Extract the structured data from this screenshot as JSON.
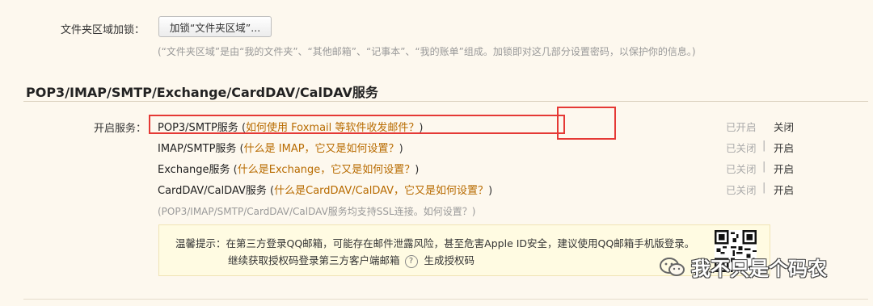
{
  "folder_lock": {
    "label": "文件夹区域加锁：",
    "button": "加锁“文件夹区域”...",
    "hint": "(“文件夹区域”是由“我的文件夹”、“其他邮箱”、“记事本”、“我的账单”组成。加锁即对这几部分设置密码，以保护你的信息。)"
  },
  "section": {
    "title": "POP3/IMAP/SMTP/Exchange/CardDAV/CalDAV服务"
  },
  "services": {
    "label": "开启服务：",
    "rows": [
      {
        "name": "POP3/SMTP服务",
        "open": " (",
        "help": "如何使用 Foxmail 等软件收发邮件？",
        "close": ")",
        "status": "已开启",
        "action": "关闭"
      },
      {
        "name": "IMAP/SMTP服务",
        "open": " (",
        "help": "什么是 IMAP，它又是如何设置？",
        "close": ")",
        "status": "已关闭",
        "action": "开启"
      },
      {
        "name": "Exchange服务",
        "open": " (",
        "help": "什么是Exchange，它又是如何设置？",
        "close": ")",
        "status": "已关闭",
        "action": "开启"
      },
      {
        "name": "CardDAV/CalDAV服务",
        "open": " (",
        "help": "什么是CardDAV/CalDAV，它又是如何设置？",
        "close": ")",
        "status": "已关闭",
        "action": "开启"
      }
    ],
    "separator": "|",
    "ssl_note": "(POP3/IMAP/SMTP/CardDAV/CalDAV服务均支持SSL连接。如何设置？)"
  },
  "warning": {
    "line1": "温馨提示：在第三方登录QQ邮箱，可能存在邮件泄露风险，甚至危害Apple ID安全，建议使用QQ邮箱手机版登录。",
    "line2": "继续获取授权码登录第三方客户端邮箱",
    "help_glyph": "?",
    "generate_link": "生成授权码"
  },
  "watermark": {
    "text": "我不只是个码农",
    "icon": "wechat-icon"
  }
}
